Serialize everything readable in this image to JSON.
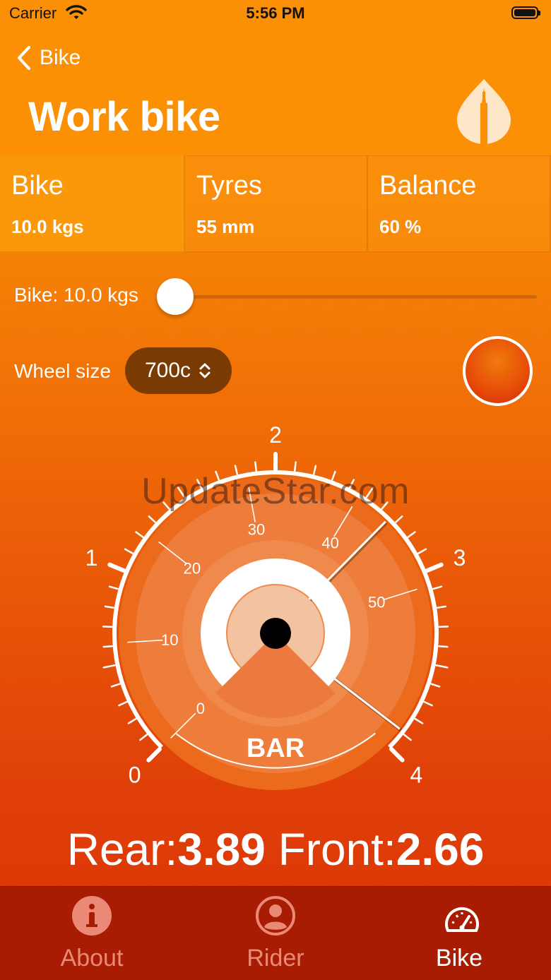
{
  "status": {
    "carrier": "Carrier",
    "time": "5:56 PM"
  },
  "nav": {
    "back_label": "Bike",
    "title": "Work bike"
  },
  "stats": [
    {
      "label": "Bike",
      "value": "10.0 kgs"
    },
    {
      "label": "Tyres",
      "value": "55 mm"
    },
    {
      "label": "Balance",
      "value": "60 %"
    }
  ],
  "slider": {
    "label": "Bike: 10.0 kgs",
    "value_fraction": 0.0
  },
  "wheel": {
    "label": "Wheel size",
    "value": "700c"
  },
  "gauge": {
    "outer_labels": [
      "0",
      "1",
      "2",
      "3",
      "4"
    ],
    "inner_labels": [
      "0",
      "10",
      "20",
      "30",
      "40",
      "50"
    ],
    "unit": "BAR",
    "rear_value": 3.89,
    "front_value": 2.66
  },
  "watermark": "UpdateStar.com",
  "readout": {
    "rear_label": "Rear:",
    "rear_value": "3.89",
    "front_label": "Front:",
    "front_value": "2.66"
  },
  "tabs": [
    {
      "label": "About",
      "icon": "info-icon",
      "active": false
    },
    {
      "label": "Rider",
      "icon": "person-icon",
      "active": false
    },
    {
      "label": "Bike",
      "icon": "speedometer-icon",
      "active": true
    }
  ],
  "colors": {
    "accent": "#fb9005",
    "tabbar": "#a81c04",
    "wheel_select": "#7a3a04"
  }
}
